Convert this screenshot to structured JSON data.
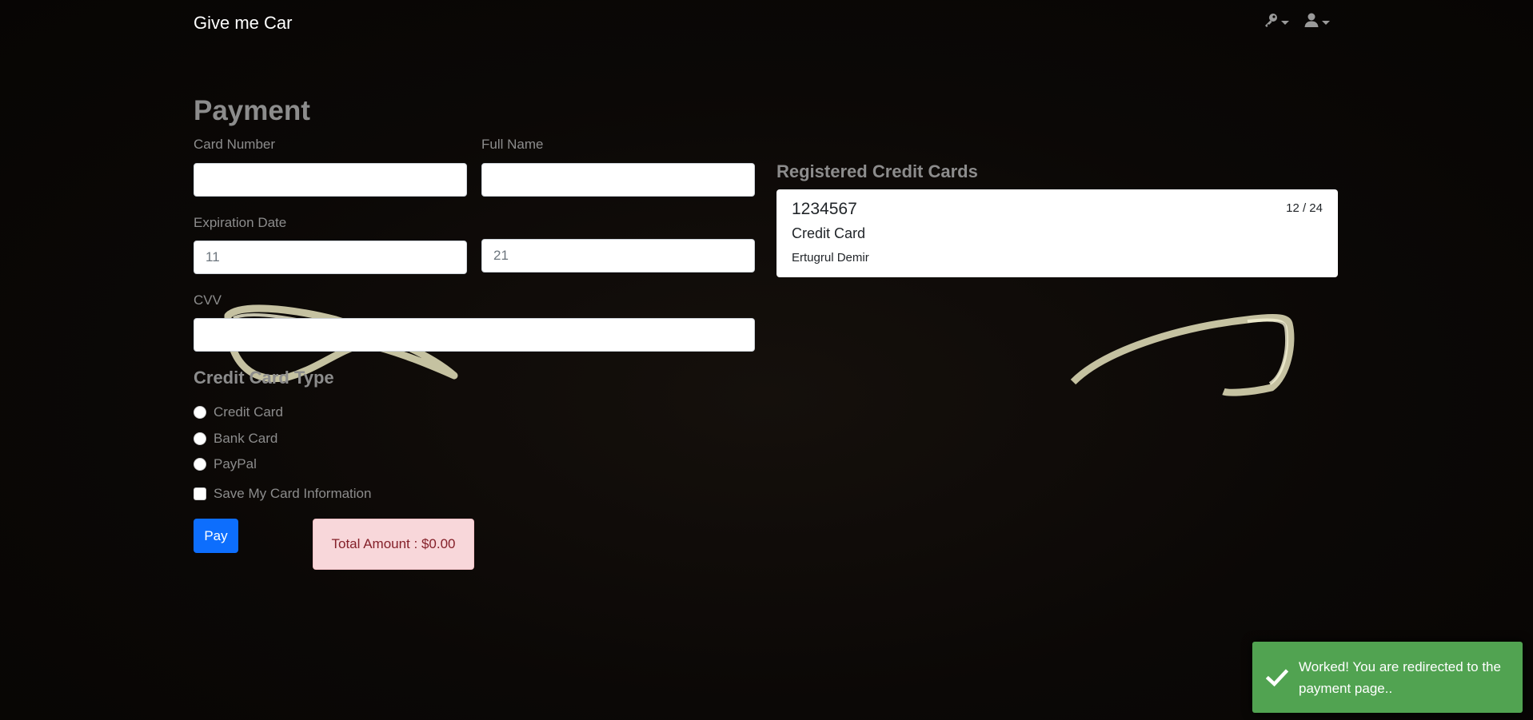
{
  "navbar": {
    "brand": "Give me Car",
    "key_icon": "key-icon",
    "user_icon": "user-icon"
  },
  "page": {
    "title": "Payment"
  },
  "form": {
    "card_number_label": "Card Number",
    "card_number_value": "",
    "full_name_label": "Full Name",
    "full_name_value": "",
    "expiration_label": "Expiration Date",
    "expiration_month_placeholder": "11",
    "expiration_year_placeholder": "21",
    "cvv_label": "CVV",
    "cvv_value": "",
    "card_type_title": "Credit Card Type",
    "card_type_options": [
      {
        "label": "Credit Card",
        "selected": false
      },
      {
        "label": "Bank Card",
        "selected": false
      },
      {
        "label": "PayPal",
        "selected": false
      }
    ],
    "save_card_label": "Save My Card Information",
    "save_card_checked": false,
    "pay_label": "Pay",
    "total_amount": "Total Amount : $0.00"
  },
  "registered_cards": {
    "title": "Registered Credit Cards",
    "items": [
      {
        "number": "1234567",
        "type": "Credit Card",
        "holder": "Ertugrul Demir",
        "expiry": "12 / 24"
      }
    ]
  },
  "toast": {
    "icon": "checkmark-icon",
    "message": "Worked! You are redirected to the payment page..",
    "color": "#51a351"
  },
  "colors": {
    "primary": "#0d6efd",
    "alert_danger_bg": "#f8d7da",
    "alert_danger_text": "#842029",
    "muted_text": "#8c8c8c"
  }
}
